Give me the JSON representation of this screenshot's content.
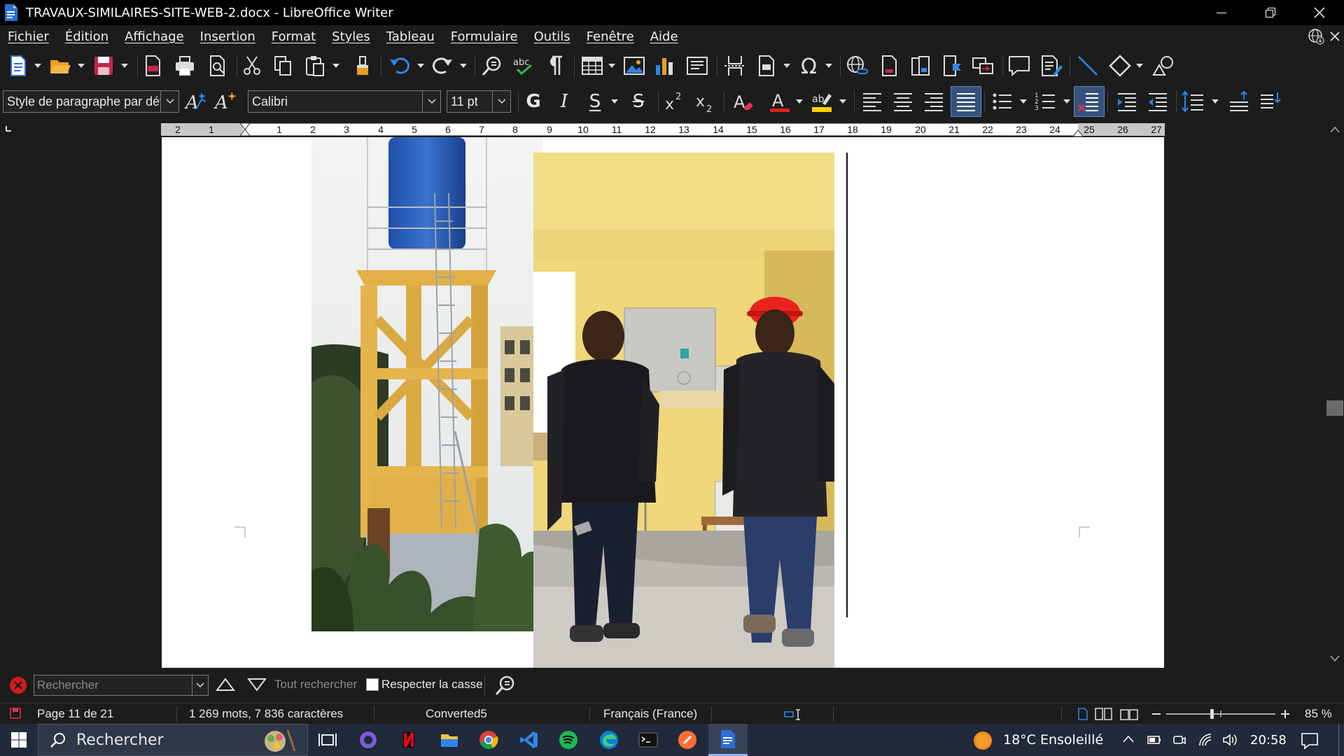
{
  "window": {
    "title": "TRAVAUX-SIMILAIRES-SITE-WEB-2.docx - LibreOffice Writer"
  },
  "menu": [
    "Fichier",
    "Édition",
    "Affichage",
    "Insertion",
    "Format",
    "Styles",
    "Tableau",
    "Formulaire",
    "Outils",
    "Fenêtre",
    "Aide"
  ],
  "formatting": {
    "paragraph_style": "Style de paragraphe par déf.",
    "font_name": "Calibri",
    "font_size": "11 pt",
    "bold_glyph": "G",
    "italic_glyph": "I",
    "underline_glyph": "S",
    "strike_glyph": "S"
  },
  "ruler": {
    "labels": [
      "2",
      "1",
      "1",
      "2",
      "3",
      "4",
      "5",
      "6",
      "7",
      "8",
      "9",
      "10",
      "11",
      "12",
      "13",
      "14",
      "15",
      "16",
      "17",
      "18",
      "19",
      "20",
      "21",
      "22",
      "23",
      "24",
      "25",
      "26",
      "27"
    ]
  },
  "find": {
    "placeholder": "Rechercher",
    "find_all": "Tout rechercher",
    "match_case": "Respecter la casse"
  },
  "status": {
    "page": "Page 11 de 21",
    "words": "1 269 mots, 7 836 caractères",
    "style": "Converted5",
    "language": "Français (France)",
    "zoom": "85 %"
  },
  "taskbar": {
    "search": "Rechercher",
    "weather": "18°C  Ensoleillé",
    "time": "20:58"
  },
  "colors": {
    "accent": "#2f6fdb",
    "font_color": "#e02020",
    "highlight": "#ffd000"
  }
}
